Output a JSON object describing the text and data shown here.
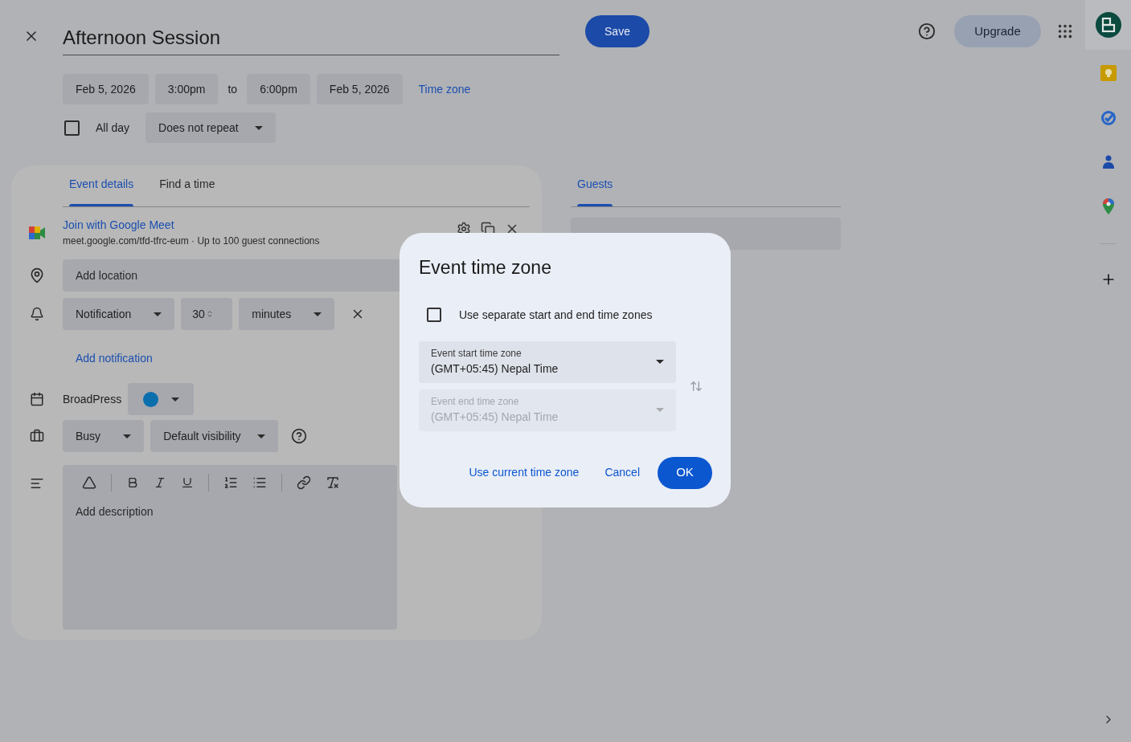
{
  "header": {
    "title": "Afternoon Session",
    "save": "Save",
    "upgrade": "Upgrade"
  },
  "when": {
    "start_date": "Feb 5, 2026",
    "start_time": "3:00pm",
    "separator": "to",
    "end_time": "6:00pm",
    "end_date": "Feb 5, 2026",
    "time_zone_link": "Time zone"
  },
  "all_day": {
    "label": "All day",
    "checked": false
  },
  "repeat": "Does not repeat",
  "tabs": [
    {
      "label": "Event details",
      "selected": true
    },
    {
      "label": "Find a time",
      "selected": false
    }
  ],
  "meet": {
    "link": "Join with Google Meet",
    "detail": "meet.google.com/tfd-tfrc-eum · Up to 100 guest connections"
  },
  "location": {
    "placeholder": "Add location"
  },
  "notification": {
    "type": "Notification",
    "amount": "30",
    "unit": "minutes"
  },
  "add_notification": "Add notification",
  "calendar": {
    "name": "BroadPress",
    "color": "#0b6fae"
  },
  "availability": "Busy",
  "visibility": "Default visibility",
  "description": {
    "placeholder": "Add description"
  },
  "guests": {
    "tab": "Guests"
  },
  "dialog": {
    "title": "Event time zone",
    "separate": {
      "label": "Use separate start and end time zones",
      "checked": false
    },
    "fields": [
      {
        "label": "Event start time zone",
        "value": "(GMT+05:45) Nepal Time",
        "disabled": false
      },
      {
        "label": "Event end time zone",
        "value": "(GMT+05:45) Nepal Time",
        "disabled": true
      }
    ],
    "buttons": [
      "Use current time zone",
      "Cancel",
      "OK"
    ]
  }
}
